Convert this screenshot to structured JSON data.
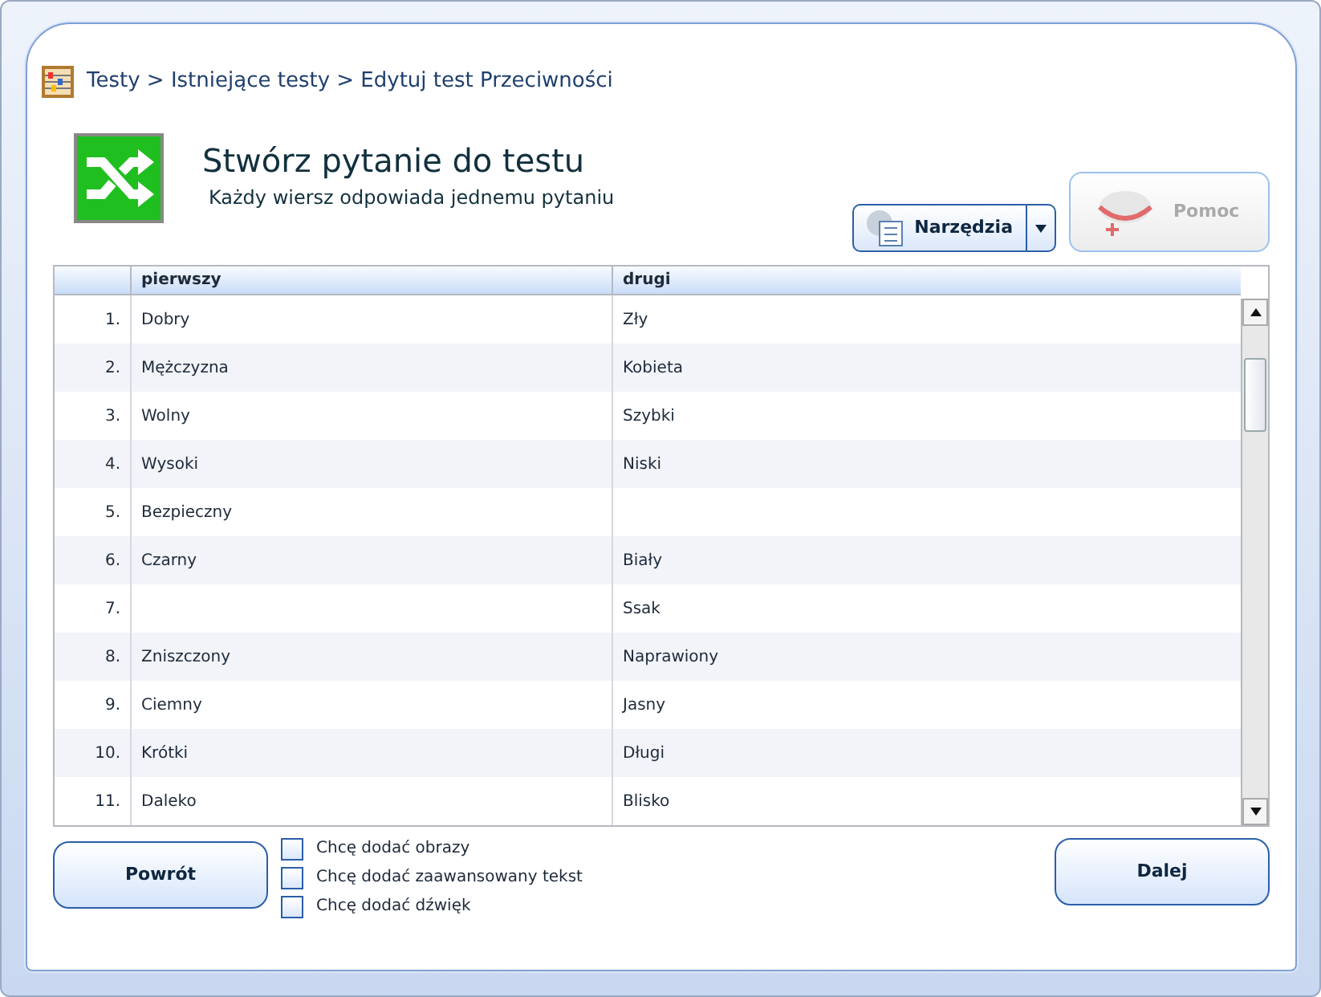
{
  "breadcrumb": "Testy > Istniejące testy > Edytuj test Przeciwności",
  "header": {
    "title": "Stwórz pytanie do testu",
    "subtitle": "Każdy wiersz odpowiada jednemu pytaniu"
  },
  "toolbar": {
    "tools_button": "Narzędzia",
    "help_button": {
      "label": "Pomoc",
      "disabled": true
    }
  },
  "table": {
    "columns": [
      "pierwszy",
      "drugi"
    ],
    "rows": [
      {
        "number": "1.",
        "first": "Dobry",
        "second": "Zły"
      },
      {
        "number": "2.",
        "first": "Mężczyzna",
        "second": "Kobieta"
      },
      {
        "number": "3.",
        "first": "Wolny",
        "second": "Szybki"
      },
      {
        "number": "4.",
        "first": "Wysoki",
        "second": "Niski"
      },
      {
        "number": "5.",
        "first": "Bezpieczny"
      },
      {
        "number": "6.",
        "first": "Czarny",
        "second": "Biały"
      },
      {
        "number": "7.",
        "second": "Ssak"
      },
      {
        "number": "8.",
        "first": "Zniszczony",
        "second": "Naprawiony"
      },
      {
        "number": "9.",
        "first": "Ciemny",
        "second": "Jasny"
      },
      {
        "number": "10.",
        "first": "Krótki",
        "second": "Długi"
      },
      {
        "number": "11.",
        "first": "Daleko",
        "second": "Blisko"
      }
    ]
  },
  "back_button": "Powrót",
  "options": [
    {
      "label": "Chcę dodać obrazy",
      "checked": false
    },
    {
      "label": "Chcę dodać zaawansowany tekst",
      "checked": false
    },
    {
      "label": "Chcę dodać dźwięk",
      "checked": false
    }
  ],
  "next_button": "Dalej"
}
